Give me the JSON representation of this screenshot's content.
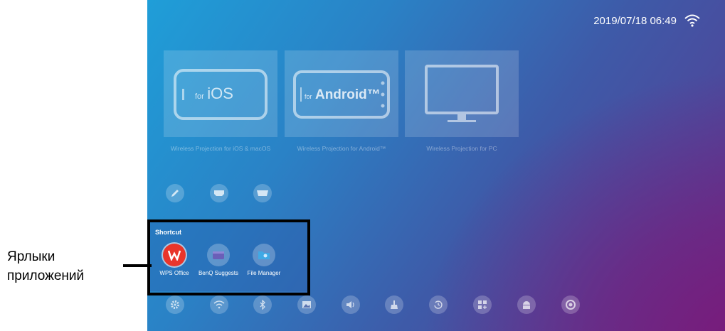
{
  "status": {
    "datetime": "2019/07/18 06:49",
    "wifi_icon": "wifi-icon"
  },
  "cards": [
    {
      "label": "Wireless Projection for iOS & macOS",
      "device_for": "for",
      "device_name": "iOS",
      "icon": "phone-ios-icon"
    },
    {
      "label": "Wireless Projection for Android™",
      "device_for": "for",
      "device_name": "Android™",
      "icon": "phone-android-icon"
    },
    {
      "label": "Wireless Projection for PC",
      "icon": "monitor-icon"
    }
  ],
  "inputs": [
    {
      "icon": "pencil-icon"
    },
    {
      "icon": "hdmi-icon"
    },
    {
      "icon": "vga-icon"
    }
  ],
  "shortcut": {
    "title": "Shortcut",
    "apps": [
      {
        "label": "WPS Office",
        "icon": "wps-office-icon",
        "color": "#e8352b"
      },
      {
        "label": "BenQ Suggests",
        "icon": "benq-suggests-icon",
        "color": "#6a5fb8"
      },
      {
        "label": "File Manager",
        "icon": "file-manager-icon",
        "color": "#3fa9e5"
      }
    ]
  },
  "bottom_bar": [
    {
      "icon": "gear-icon"
    },
    {
      "icon": "wifi-icon"
    },
    {
      "icon": "bluetooth-icon"
    },
    {
      "icon": "picture-icon"
    },
    {
      "icon": "speaker-icon"
    },
    {
      "icon": "broom-icon"
    },
    {
      "icon": "update-icon"
    },
    {
      "icon": "add-app-icon"
    },
    {
      "icon": "android-icon"
    },
    {
      "icon": "support-icon"
    }
  ],
  "callout": {
    "line1": "Ярлыки",
    "line2": "приложений"
  },
  "colors": {
    "accent": "#1f9ed8",
    "frame": "#000000"
  }
}
